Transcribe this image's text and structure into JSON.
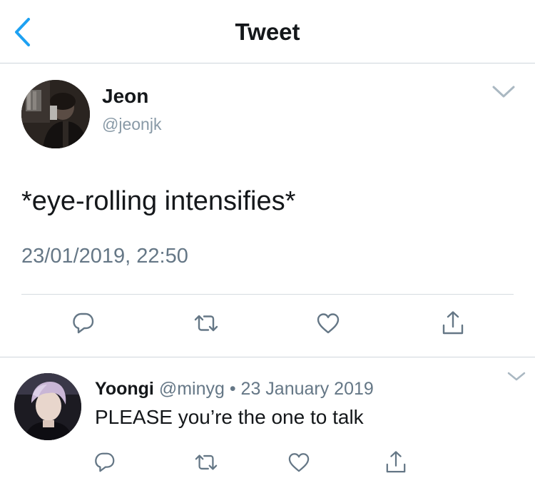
{
  "header": {
    "title": "Tweet"
  },
  "main_tweet": {
    "author_name": "Jeon",
    "author_handle": "@jeonjk",
    "text": "*eye-rolling intensifies*",
    "timestamp": "23/01/2019, 22:50"
  },
  "reply": {
    "author_name": "Yoongi",
    "author_handle": "@minyg",
    "separator": " • ",
    "date": "23 January 2019",
    "text": "PLEASE you’re the one to talk"
  },
  "colors": {
    "accent": "#1da1f2",
    "icon_gray": "#657786",
    "divider": "#cfd6db",
    "text": "#14171a"
  },
  "icons": [
    "chevron-left-icon",
    "chevron-down-icon",
    "reply-icon",
    "retweet-icon",
    "like-icon",
    "share-icon"
  ]
}
